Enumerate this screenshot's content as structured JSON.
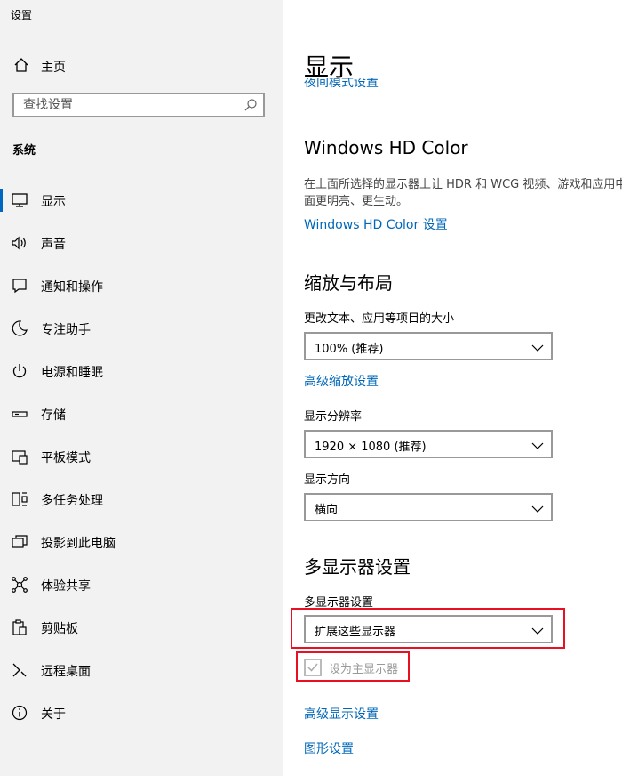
{
  "window": {
    "title": "设置"
  },
  "sidebar": {
    "home_label": "主页",
    "search_placeholder": "查找设置",
    "section_label": "系统",
    "items": [
      {
        "label": "显示",
        "icon": "monitor-icon",
        "active": true
      },
      {
        "label": "声音",
        "icon": "speaker-icon"
      },
      {
        "label": "通知和操作",
        "icon": "notification-icon"
      },
      {
        "label": "专注助手",
        "icon": "moon-icon"
      },
      {
        "label": "电源和睡眠",
        "icon": "power-icon"
      },
      {
        "label": "存储",
        "icon": "storage-icon"
      },
      {
        "label": "平板模式",
        "icon": "tablet-mode-icon"
      },
      {
        "label": "多任务处理",
        "icon": "multitask-icon"
      },
      {
        "label": "投影到此电脑",
        "icon": "project-icon"
      },
      {
        "label": "体验共享",
        "icon": "share-icon"
      },
      {
        "label": "剪贴板",
        "icon": "clipboard-icon"
      },
      {
        "label": "远程桌面",
        "icon": "remote-desktop-icon"
      },
      {
        "label": "关于",
        "icon": "info-icon"
      }
    ]
  },
  "main": {
    "page_title": "显示",
    "night_light_link": "夜间模式设置",
    "hdr": {
      "title": "Windows HD Color",
      "description": "在上面所选择的显示器上让 HDR 和 WCG 视频、游戏和应用中的画面更明亮、更生动。",
      "link": "Windows HD Color 设置"
    },
    "scale": {
      "title": "缩放与布局",
      "text_size_label": "更改文本、应用等项目的大小",
      "text_size_value": "100% (推荐)",
      "advanced_scaling_link": "高级缩放设置",
      "resolution_label": "显示分辨率",
      "resolution_value": "1920 × 1080 (推荐)",
      "orientation_label": "显示方向",
      "orientation_value": "横向"
    },
    "multi_display": {
      "title": "多显示器设置",
      "label": "多显示器设置",
      "value": "扩展这些显示器",
      "primary_checkbox_label": "设为主显示器",
      "primary_checked": true,
      "primary_disabled": true
    },
    "advanced_display_link": "高级显示设置",
    "graphics_link": "图形设置"
  },
  "colors": {
    "accent": "#0067b8",
    "highlight_border": "#e81123",
    "sidebar_bg": "#f2f2f2"
  }
}
